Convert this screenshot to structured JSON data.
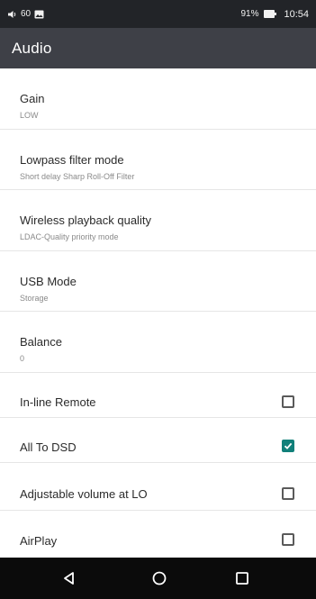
{
  "status_bar": {
    "volume_text": "60",
    "battery_text": "91%",
    "time": "10:54",
    "icons": [
      "volume-icon",
      "gallery-notification-icon",
      "battery-icon"
    ]
  },
  "app_bar": {
    "title": "Audio"
  },
  "settings": [
    {
      "title": "Gain",
      "subtitle": "LOW"
    },
    {
      "title": "Lowpass filter mode",
      "subtitle": "Short delay Sharp Roll-Off Filter"
    },
    {
      "title": "Wireless playback quality",
      "subtitle": "LDAC-Quality priority mode"
    },
    {
      "title": "USB Mode",
      "subtitle": "Storage"
    },
    {
      "title": "Balance",
      "subtitle": "0"
    },
    {
      "title": "In-line Remote",
      "checked": false
    },
    {
      "title": "All To DSD",
      "checked": true
    },
    {
      "title": "Adjustable volume at LO",
      "checked": false
    },
    {
      "title": "AirPlay",
      "checked": false
    }
  ],
  "nav_bar": {
    "buttons": [
      "back-icon",
      "home-icon",
      "recents-icon"
    ]
  },
  "colors": {
    "status_bar": "#222428",
    "app_bar": "#3e4047",
    "accent": "#11807a",
    "nav_bar": "#0b0b0b"
  }
}
